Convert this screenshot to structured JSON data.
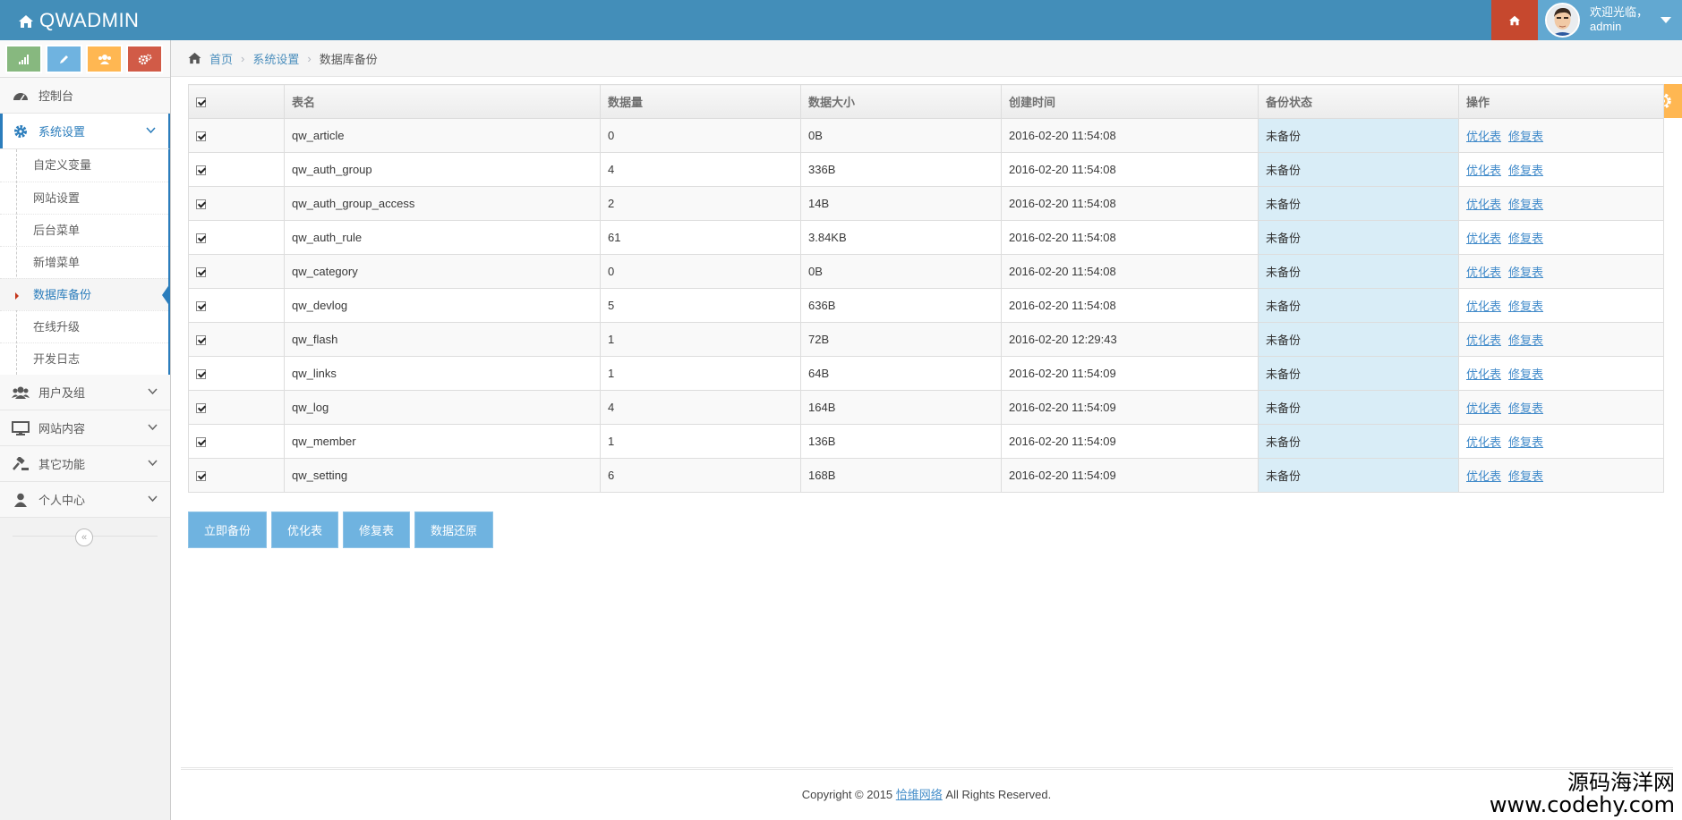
{
  "navbar": {
    "brand": "QWADMIN",
    "welcome": "欢迎光临，",
    "username": "admin"
  },
  "colors": {
    "navbar": "#438eb9",
    "home_btn": "#c6482e",
    "user_area": "#62a8d1",
    "shortcut_1": "#87b87f",
    "shortcut_2": "#6fb3e0",
    "shortcut_3": "#ffb752",
    "shortcut_4": "#d15b47",
    "status_bg": "#d9edf7",
    "button": "#6fb3e0"
  },
  "shortcuts": [
    {
      "icon": "signal-icon"
    },
    {
      "icon": "pencil-icon"
    },
    {
      "icon": "users-icon"
    },
    {
      "icon": "cogs-icon"
    }
  ],
  "sidebar": {
    "dashboard": "控制台",
    "system_settings": "系统设置",
    "submenu": [
      "自定义变量",
      "网站设置",
      "后台菜单",
      "新增菜单",
      "数据库备份",
      "在线升级",
      "开发日志"
    ],
    "users_groups": "用户及组",
    "site_content": "网站内容",
    "other_functions": "其它功能",
    "personal_center": "个人中心",
    "collapse": "«"
  },
  "breadcrumb": {
    "home": "首页",
    "parent": "系统设置",
    "current": "数据库备份"
  },
  "table": {
    "headers": [
      "表名",
      "数据量",
      "数据大小",
      "创建时间",
      "备份状态",
      "操作"
    ],
    "rows": [
      {
        "name": "qw_article",
        "count": "0",
        "size": "0B",
        "created": "2016-02-20 11:54:08",
        "status": "未备份"
      },
      {
        "name": "qw_auth_group",
        "count": "4",
        "size": "336B",
        "created": "2016-02-20 11:54:08",
        "status": "未备份"
      },
      {
        "name": "qw_auth_group_access",
        "count": "2",
        "size": "14B",
        "created": "2016-02-20 11:54:08",
        "status": "未备份"
      },
      {
        "name": "qw_auth_rule",
        "count": "61",
        "size": "3.84KB",
        "created": "2016-02-20 11:54:08",
        "status": "未备份"
      },
      {
        "name": "qw_category",
        "count": "0",
        "size": "0B",
        "created": "2016-02-20 11:54:08",
        "status": "未备份"
      },
      {
        "name": "qw_devlog",
        "count": "5",
        "size": "636B",
        "created": "2016-02-20 11:54:08",
        "status": "未备份"
      },
      {
        "name": "qw_flash",
        "count": "1",
        "size": "72B",
        "created": "2016-02-20 12:29:43",
        "status": "未备份"
      },
      {
        "name": "qw_links",
        "count": "1",
        "size": "64B",
        "created": "2016-02-20 11:54:09",
        "status": "未备份"
      },
      {
        "name": "qw_log",
        "count": "4",
        "size": "164B",
        "created": "2016-02-20 11:54:09",
        "status": "未备份"
      },
      {
        "name": "qw_member",
        "count": "1",
        "size": "136B",
        "created": "2016-02-20 11:54:09",
        "status": "未备份"
      },
      {
        "name": "qw_setting",
        "count": "6",
        "size": "168B",
        "created": "2016-02-20 11:54:09",
        "status": "未备份"
      }
    ],
    "op_optimize": "优化表",
    "op_repair": "修复表"
  },
  "buttons": {
    "backup_now": "立即备份",
    "optimize": "优化表",
    "repair": "修复表",
    "restore": "数据还原"
  },
  "footer": {
    "prefix": "Copyright © 2015 ",
    "company": "恰维网络",
    "suffix": " All Rights Reserved."
  },
  "watermark": {
    "line1": "源码海洋网",
    "line2": "www.codehy.com"
  }
}
